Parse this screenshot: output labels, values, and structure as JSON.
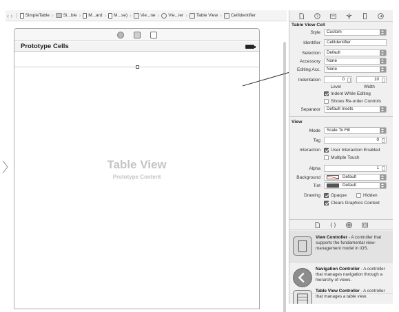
{
  "jumpbar": {
    "items": [
      "SimpleTable",
      "Si...ble",
      "M...ard",
      "M...se)",
      "Vie...ne",
      "Vie...ler",
      "Table View",
      "CellIdentifier"
    ]
  },
  "canvas": {
    "navbar_title": "Prototype Cells",
    "table_title": "Table View",
    "table_subtitle": "Prototype Content"
  },
  "inspector": {
    "cell_section": {
      "title": "Table View Cell",
      "style_label": "Style",
      "style_value": "Custom",
      "identifier_label": "Identifier",
      "identifier_value": "CellIdentifier",
      "selection_label": "Selection",
      "selection_value": "Default",
      "accessory_label": "Accessory",
      "accessory_value": "None",
      "editing_label": "Editing Acc.",
      "editing_value": "None",
      "indentation_label": "Indentation",
      "level_value": "0",
      "width_value": "10",
      "level_label": "Level",
      "width_label": "Width",
      "indent_editing": "Indent While Editing",
      "show_reorder": "Shows Re-order Controls",
      "separator_label": "Separator",
      "separator_value": "Default Insets"
    },
    "view_section": {
      "title": "View",
      "mode_label": "Mode",
      "mode_value": "Scale To Fill",
      "tag_label": "Tag",
      "tag_value": "0",
      "interaction_label": "Interaction",
      "user_interaction": "User Interaction Enabled",
      "multiple_touch": "Multiple Touch",
      "alpha_label": "Alpha",
      "alpha_value": "1",
      "background_label": "Background",
      "background_value": "Default",
      "tint_label": "Tint",
      "tint_value": "Default",
      "drawing_label": "Drawing",
      "opaque": "Opaque",
      "hidden": "Hidden",
      "clears_context": "Clears Graphics Context"
    }
  },
  "library": {
    "items": [
      {
        "name": "View Controller",
        "desc": " - A controller that supports the fundamental view-management model in iOS."
      },
      {
        "name": "Navigation Controller",
        "desc": " - A controller that manages navigation through a hierarchy of views."
      },
      {
        "name": "Table View Controller",
        "desc": " - A controller that manages a table view."
      }
    ]
  }
}
